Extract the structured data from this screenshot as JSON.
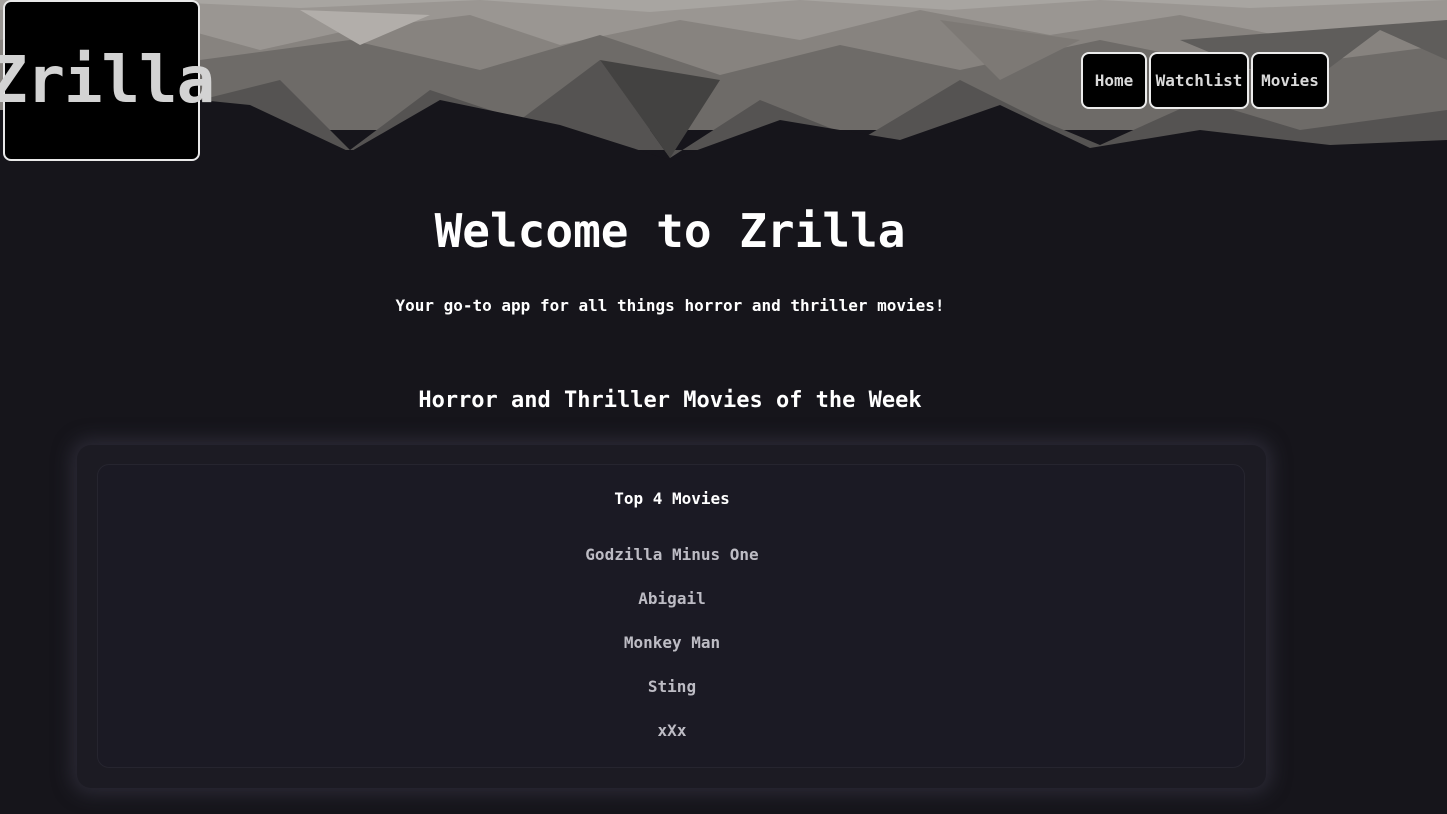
{
  "header": {
    "logo_text": "Zrilla",
    "nav": {
      "home_label": "Home",
      "watchlist_label": "Watchlist",
      "movies_label": "Movies"
    }
  },
  "main": {
    "title": "Welcome to Zrilla",
    "subtitle": "Your go-to app for all things horror and thriller movies!",
    "section_title": "Horror and Thriller Movies of the Week",
    "card": {
      "list_title": "Top 4 Movies",
      "movies": [
        "Godzilla Minus One",
        "Abigail",
        "Monkey Man",
        "Sting",
        "xXx"
      ]
    }
  },
  "colors": {
    "background": "#16151b",
    "card_background": "#1c1b23",
    "text_primary": "#ffffff",
    "text_secondary": "#bdbcc4"
  }
}
